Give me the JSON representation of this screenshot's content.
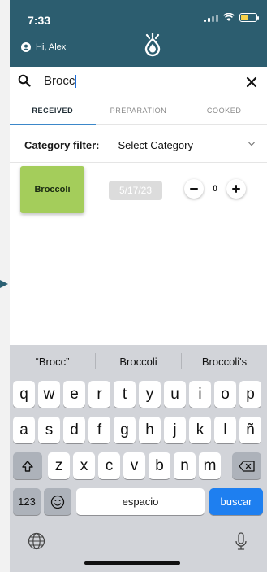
{
  "status_bar": {
    "time": "7:33"
  },
  "header": {
    "greeting": "Hi, Alex"
  },
  "search": {
    "query": "Brocc"
  },
  "tabs": [
    {
      "label": "RECEIVED",
      "active": true
    },
    {
      "label": "PREPARATION",
      "active": false
    },
    {
      "label": "COOKED",
      "active": false
    }
  ],
  "filter": {
    "label": "Category filter:",
    "selected": "Select Category"
  },
  "items": [
    {
      "name": "Broccoli",
      "date": "5/17/23",
      "quantity": "0",
      "color": "#a4cd5b"
    }
  ],
  "keyboard": {
    "suggestions": [
      "“Brocc”",
      "Broccoli",
      "Broccoli's"
    ],
    "row1": [
      "q",
      "w",
      "e",
      "r",
      "t",
      "y",
      "u",
      "i",
      "o",
      "p"
    ],
    "row2": [
      "a",
      "s",
      "d",
      "f",
      "g",
      "h",
      "j",
      "k",
      "l",
      "ñ"
    ],
    "row3": [
      "z",
      "x",
      "c",
      "v",
      "b",
      "n",
      "m"
    ],
    "numbers_key": "123",
    "space_key": "espacio",
    "action_key": "buscar"
  },
  "colors": {
    "header": "#2c5d6f",
    "accent": "#3b87c9",
    "action": "#1e7ff0"
  }
}
